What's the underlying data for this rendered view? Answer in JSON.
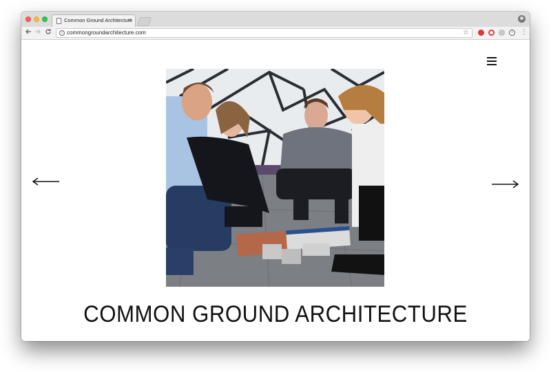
{
  "browser": {
    "tab": {
      "title": "Common Ground Architecture",
      "close": "×"
    },
    "toolbar": {
      "url": "commongroundarchitecture.com"
    }
  },
  "site": {
    "title": "COMMON GROUND ARCHITECTURE",
    "menu_icon": "hamburger-icon",
    "prev_icon": "arrow-left-icon",
    "next_icon": "arrow-right-icon"
  }
}
